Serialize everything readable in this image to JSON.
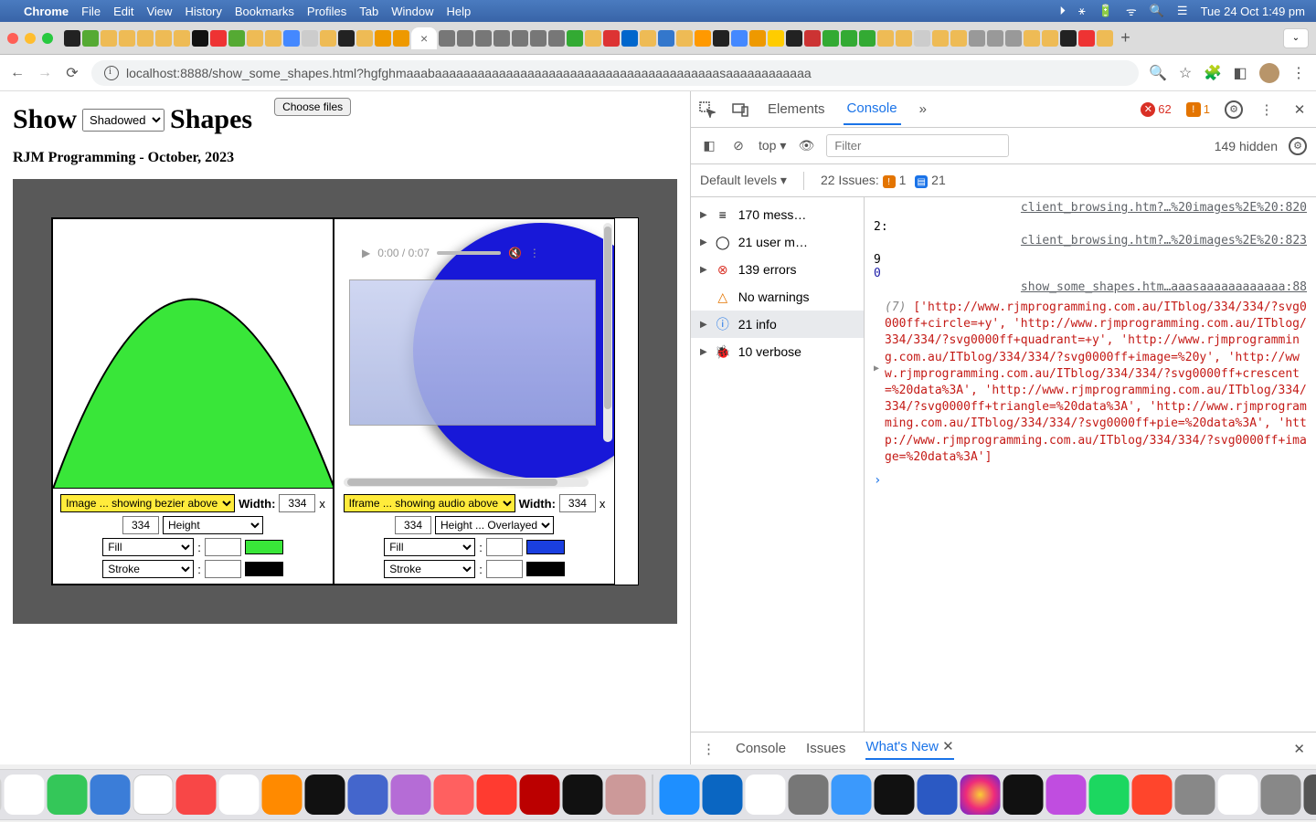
{
  "menubar": {
    "app": "Chrome",
    "items": [
      "File",
      "Edit",
      "View",
      "History",
      "Bookmarks",
      "Profiles",
      "Tab",
      "Window",
      "Help"
    ],
    "datetime": "Tue 24 Oct  1:49 pm"
  },
  "addressbar": {
    "url": "localhost:8888/show_some_shapes.html?hgfghmaaabaaaaaaaaaaaaaaaaaaaaaaaaaaaaaaaaaaaaaaaasaaaaaaaaaaaa"
  },
  "page": {
    "title_left": "Show",
    "title_select": "Shadowed",
    "title_right": "Shapes",
    "choose_files": "Choose files",
    "subtitle": "RJM Programming - October, 2023",
    "panel_left": {
      "type_select": "Image ... showing bezier above",
      "width_label": "Width:",
      "width_val": "334",
      "h_val": "334",
      "h_select": "Height",
      "fill_select": "Fill",
      "fill_color": "#39e639",
      "stroke_select": "Stroke",
      "stroke_color": "#000000"
    },
    "panel_right": {
      "type_select": "Iframe ... showing audio above",
      "width_label": "Width:",
      "width_val": "334",
      "h_val": "334",
      "h_select": "Height ... Overlayed",
      "fill_select": "Fill",
      "fill_color": "#1a3fe0",
      "stroke_select": "Stroke",
      "stroke_color": "#000000",
      "media_time": "0:00 / 0:07"
    }
  },
  "devtools": {
    "tabs": {
      "elements": "Elements",
      "console": "Console"
    },
    "err_count": "62",
    "warn_count": "1",
    "toolbar": {
      "context": "top",
      "filter_placeholder": "Filter",
      "hidden": "149 hidden"
    },
    "levels": {
      "label": "Default levels",
      "issues_label": "22 Issues:",
      "issues_err": "1",
      "issues_info": "21"
    },
    "sidebar": {
      "messages": "170 mess…",
      "user": "21 user m…",
      "errors": "139 errors",
      "warnings": "No warnings",
      "info": "21 info",
      "verbose": "10 verbose"
    },
    "log": {
      "link1": "client_browsing.htm?…%20images%2E%20:820",
      "line2": "2:",
      "link2": "client_browsing.htm?…%20images%2E%20:823",
      "line9": "9",
      "line0": "0",
      "link3": "show_some_shapes.htm…aaasaaaaaaaaaaaa:88",
      "array_prefix": "(7) ",
      "array_items": [
        "'http://www.rjmprogramming.com.au/ITblog/334/334/?svg0000ff+circle=+y'",
        "'http://www.rjmprogramming.com.au/ITblog/334/334/?svg0000ff+quadrant=+y'",
        "'http://www.rjmprogramming.com.au/ITblog/334/334/?svg0000ff+image=%20y'",
        "'http://www.rjmprogramming.com.au/ITblog/334/334/?svg0000ff+crescent=%20data%3A'",
        "'http://www.rjmprogramming.com.au/ITblog/334/334/?svg0000ff+triangle=%20data%3A'",
        "'http://www.rjmprogramming.com.au/ITblog/334/334/?svg0000ff+pie=%20data%3A'",
        "'http://www.rjmprogramming.com.au/ITblog/334/334/?svg0000ff+image=%20data%3A'"
      ]
    },
    "drawer": {
      "console": "Console",
      "issues": "Issues",
      "whatsnew": "What's New"
    }
  }
}
